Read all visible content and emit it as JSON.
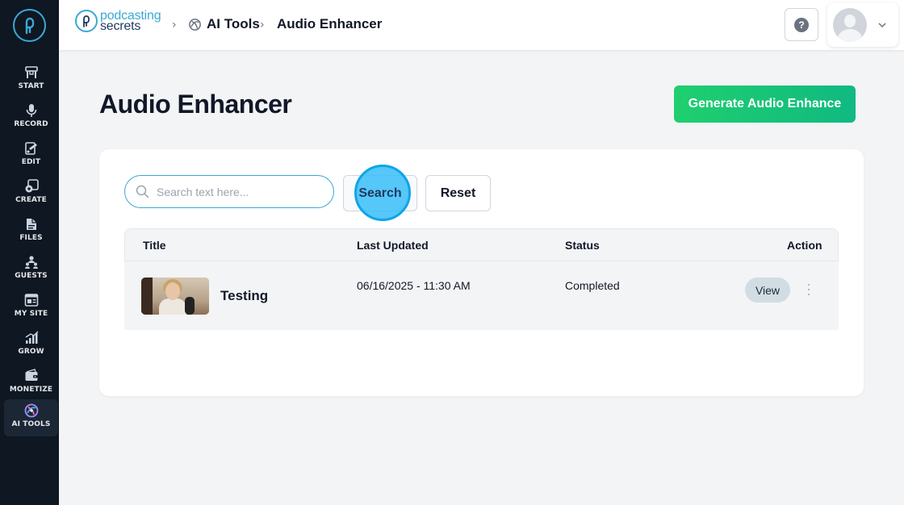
{
  "brand": {
    "line1": "podcasting",
    "line2": "secrets"
  },
  "breadcrumb": [
    {
      "label": "AI Tools"
    },
    {
      "label": "Audio Enhancer"
    }
  ],
  "sidebar": {
    "items": [
      {
        "label": "START",
        "icon": "start-icon"
      },
      {
        "label": "RECORD",
        "icon": "microphone-icon"
      },
      {
        "label": "EDIT",
        "icon": "edit-icon"
      },
      {
        "label": "CREATE",
        "icon": "create-icon"
      },
      {
        "label": "FILES",
        "icon": "files-icon"
      },
      {
        "label": "GUESTS",
        "icon": "guests-icon"
      },
      {
        "label": "MY SITE",
        "icon": "my-site-icon"
      },
      {
        "label": "GROW",
        "icon": "grow-icon"
      },
      {
        "label": "MONETIZE",
        "icon": "monetize-icon"
      },
      {
        "label": "AI TOOLS",
        "icon": "ai-tools-icon",
        "active": true
      }
    ]
  },
  "header": {
    "help_label": "?"
  },
  "page": {
    "title": "Audio Enhancer",
    "generate_label": "Generate Audio Enhance"
  },
  "search": {
    "placeholder": "Search text here...",
    "value": "",
    "search_label": "Search",
    "reset_label": "Reset"
  },
  "table": {
    "columns": [
      "Title",
      "Last Updated",
      "Status",
      "Action"
    ],
    "rows": [
      {
        "title": "Testing",
        "last_updated": "06/16/2025 - 11:30 AM",
        "status": "Completed",
        "action_label": "View"
      }
    ]
  },
  "colors": {
    "sidebar_bg": "#0e1722",
    "accent": "#3aa9d4",
    "generate_green": "#10b981",
    "highlight": "#38bdf8"
  }
}
